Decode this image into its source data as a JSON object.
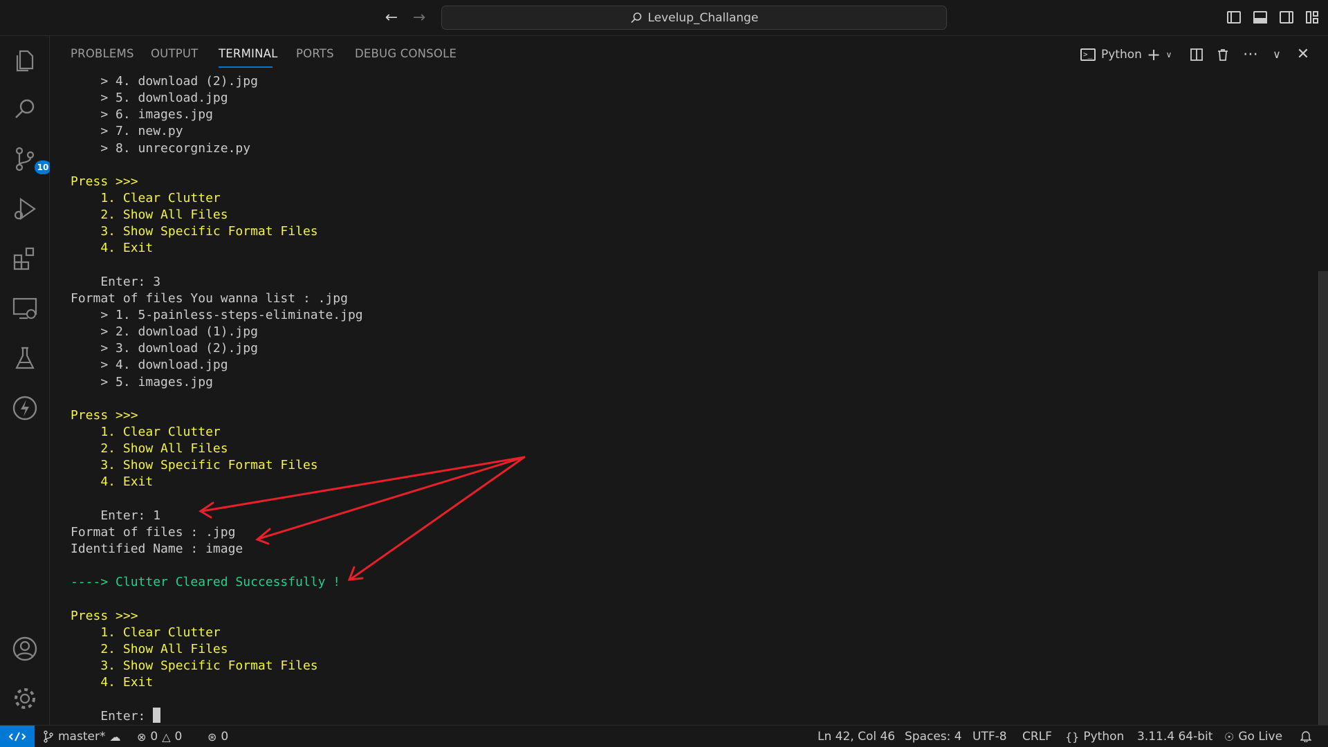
{
  "titlebar": {
    "search_text": "Levelup_Challange",
    "back_icon": "arrow-left-icon",
    "forward_icon": "arrow-right-icon"
  },
  "activity_bar": {
    "items": [
      "explorer",
      "search",
      "source-control",
      "run-and-debug",
      "extensions",
      "remote-explorer",
      "testing",
      "thunder-client",
      "accounts",
      "manage"
    ],
    "scm_badge": "10"
  },
  "panel": {
    "tabs": [
      "PROBLEMS",
      "OUTPUT",
      "TERMINAL",
      "PORTS",
      "DEBUG CONSOLE"
    ],
    "active_tab": "TERMINAL",
    "profile_label": "Python"
  },
  "terminal": {
    "lines": [
      {
        "text": "    > 4. download (2).jpg",
        "color": "default"
      },
      {
        "text": "    > 5. download.jpg",
        "color": "default"
      },
      {
        "text": "    > 6. images.jpg",
        "color": "default"
      },
      {
        "text": "    > 7. new.py",
        "color": "default"
      },
      {
        "text": "    > 8. unrecorgnize.py",
        "color": "default"
      },
      {
        "text": "",
        "color": "default"
      },
      {
        "text": "Press >>>",
        "color": "yellow"
      },
      {
        "text": "    1. Clear Clutter",
        "color": "yellow"
      },
      {
        "text": "    2. Show All Files",
        "color": "yellow"
      },
      {
        "text": "    3. Show Specific Format Files",
        "color": "yellow"
      },
      {
        "text": "    4. Exit",
        "color": "yellow"
      },
      {
        "text": "",
        "color": "default"
      },
      {
        "text": "    Enter: 3",
        "color": "default"
      },
      {
        "text": "Format of files You wanna list : .jpg",
        "color": "default"
      },
      {
        "text": "    > 1. 5-painless-steps-eliminate.jpg",
        "color": "default"
      },
      {
        "text": "    > 2. download (1).jpg",
        "color": "default"
      },
      {
        "text": "    > 3. download (2).jpg",
        "color": "default"
      },
      {
        "text": "    > 4. download.jpg",
        "color": "default"
      },
      {
        "text": "    > 5. images.jpg",
        "color": "default"
      },
      {
        "text": "",
        "color": "default"
      },
      {
        "text": "Press >>>",
        "color": "yellow"
      },
      {
        "text": "    1. Clear Clutter",
        "color": "yellow"
      },
      {
        "text": "    2. Show All Files",
        "color": "yellow"
      },
      {
        "text": "    3. Show Specific Format Files",
        "color": "yellow"
      },
      {
        "text": "    4. Exit",
        "color": "yellow"
      },
      {
        "text": "",
        "color": "default"
      },
      {
        "text": "    Enter: 1",
        "color": "default"
      },
      {
        "text": "Format of files : .jpg",
        "color": "default"
      },
      {
        "text": "Identified Name : image",
        "color": "default"
      },
      {
        "text": "",
        "color": "default"
      },
      {
        "text": "----> Clutter Cleared Successfully !",
        "color": "green"
      },
      {
        "text": "",
        "color": "default"
      },
      {
        "text": "Press >>>",
        "color": "yellow"
      },
      {
        "text": "    1. Clear Clutter",
        "color": "yellow"
      },
      {
        "text": "    2. Show All Files",
        "color": "yellow"
      },
      {
        "text": "    3. Show Specific Format Files",
        "color": "yellow"
      },
      {
        "text": "    4. Exit",
        "color": "yellow"
      },
      {
        "text": "",
        "color": "default"
      }
    ],
    "prompt": "    Enter: ",
    "colors": {
      "default": "#cccccc",
      "yellow": "#f5f543",
      "green": "#23d18b"
    }
  },
  "annotation": {
    "color": "#e8202a"
  },
  "statusbar": {
    "branch": "master*",
    "errors": "0",
    "warnings": "0",
    "ports": "0",
    "position": "Ln 42, Col 46",
    "spaces": "Spaces: 4",
    "encoding": "UTF-8",
    "eol": "CRLF",
    "language": "Python",
    "interpreter": "3.11.4 64-bit",
    "go_live": "Go Live",
    "remote_color": "#0078d4"
  }
}
